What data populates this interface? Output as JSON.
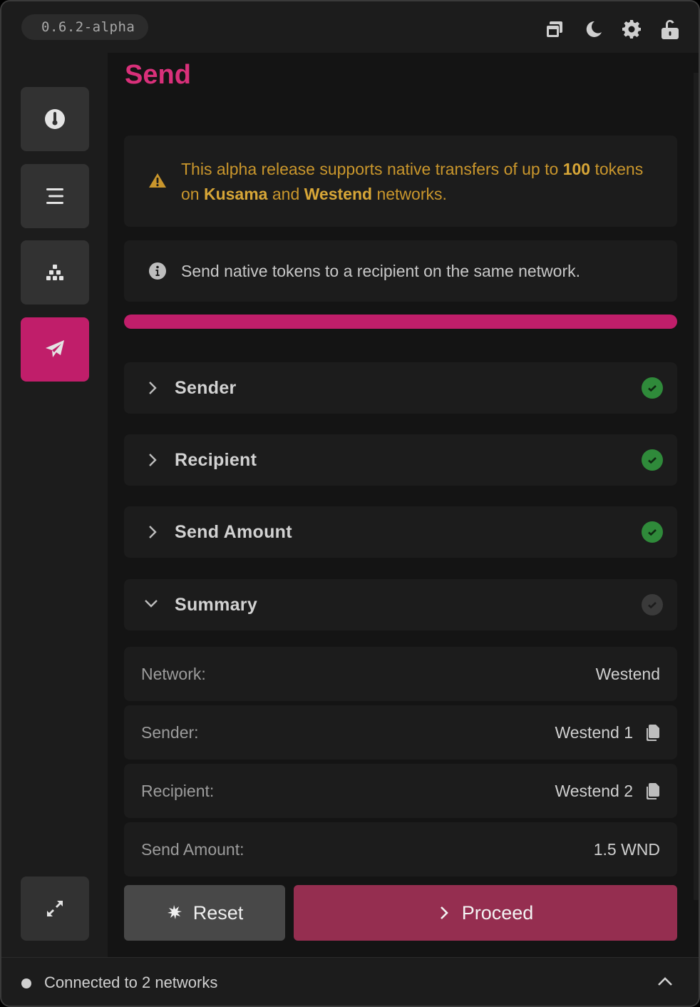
{
  "app": {
    "version": "0.6.2-alpha"
  },
  "topbar": {
    "icons": [
      "windows-icon",
      "moon-icon",
      "gear-icon",
      "unlock-icon"
    ]
  },
  "sidebar": {
    "items": [
      {
        "icon": "thermometer-icon",
        "active": false
      },
      {
        "icon": "menu-lines-icon",
        "active": false
      },
      {
        "icon": "network-icon",
        "active": false
      },
      {
        "icon": "paper-plane-icon",
        "active": true
      }
    ],
    "bottom_icon": "expand-icon"
  },
  "main": {
    "title": "Send",
    "warning": {
      "part1": "This alpha release supports native transfers of up to ",
      "bold1": "100",
      "part2": " tokens on ",
      "bold2": "Kusama",
      "part3": " and ",
      "bold3": "Westend",
      "part4": " networks."
    },
    "info": "Send native tokens to a recipient on the same network.",
    "progress": 1.0,
    "sections": [
      {
        "label": "Sender",
        "status": "complete"
      },
      {
        "label": "Recipient",
        "status": "complete"
      },
      {
        "label": "Send Amount",
        "status": "complete"
      },
      {
        "label": "Summary",
        "status": "pending",
        "expanded": true
      }
    ],
    "summary": [
      {
        "label": "Network:",
        "value": "Westend"
      },
      {
        "label": "Sender:",
        "value": "Westend 1"
      },
      {
        "label": "Recipient:",
        "value": "Westend 2"
      },
      {
        "label": "Send Amount:",
        "value": "1.5 WND"
      }
    ],
    "buttons": {
      "reset": "Reset",
      "proceed": "Proceed"
    }
  },
  "footer": {
    "status": "Connected to 2 networks"
  },
  "colors": {
    "accent": "#c01e6a",
    "warning": "#c9962c",
    "success": "#2f8a3a"
  }
}
